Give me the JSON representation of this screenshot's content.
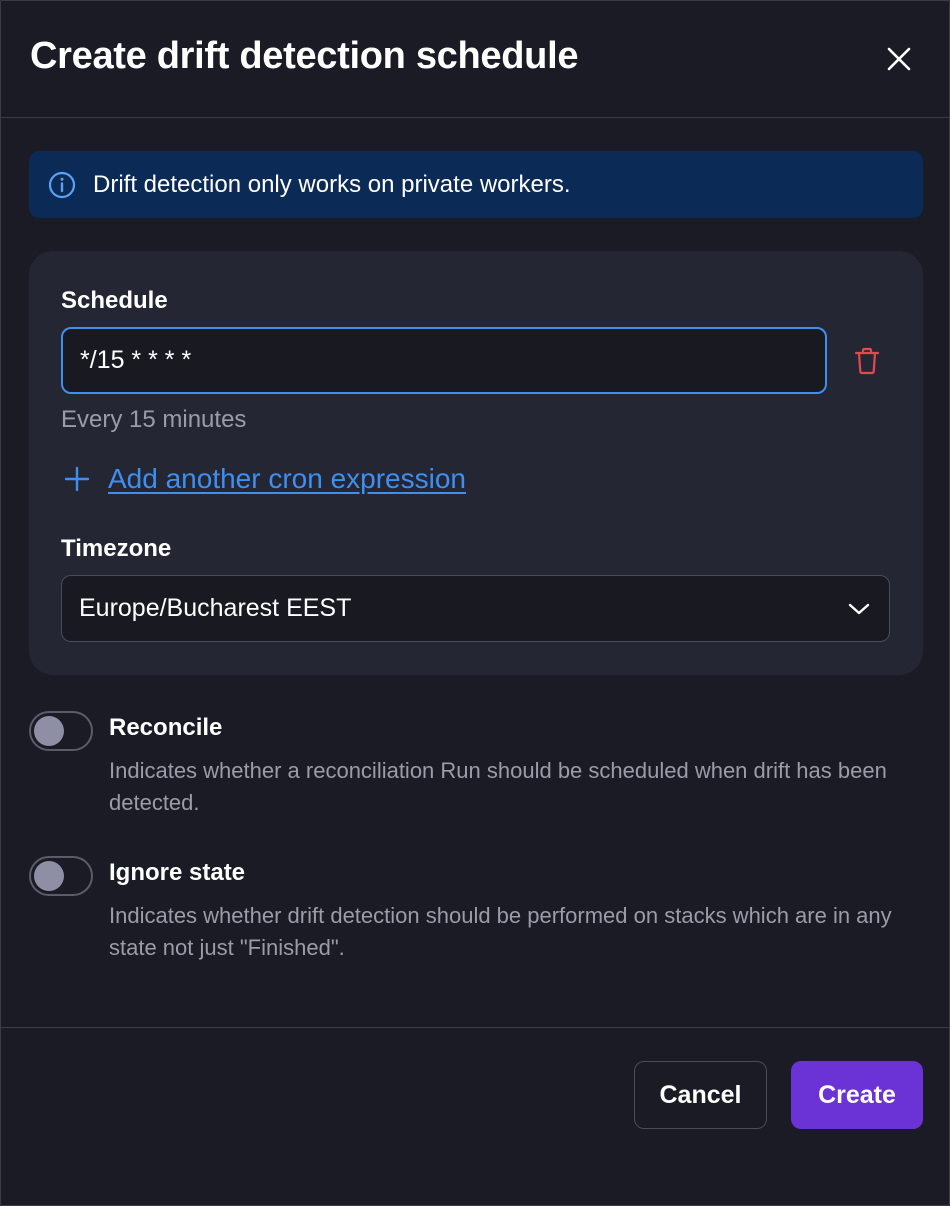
{
  "dialog": {
    "title": "Create drift detection schedule",
    "close_icon": "close-icon"
  },
  "info_banner": {
    "icon": "info-icon",
    "text": "Drift detection only works on private workers."
  },
  "schedule": {
    "label": "Schedule",
    "cron_value": "*/15 * * * *",
    "cron_description": "Every 15 minutes",
    "delete_icon": "trash-icon",
    "add_label": "Add another cron expression"
  },
  "timezone": {
    "label": "Timezone",
    "selected": "Europe/Bucharest EEST"
  },
  "options": [
    {
      "title": "Reconcile",
      "description": "Indicates whether a reconciliation Run should be scheduled when drift has been detected.",
      "enabled": false
    },
    {
      "title": "Ignore state",
      "description": "Indicates whether drift detection should be performed on stacks which are in any state not just \"Finished\".",
      "enabled": false
    }
  ],
  "footer": {
    "cancel_label": "Cancel",
    "create_label": "Create"
  },
  "colors": {
    "background": "#1a1b24",
    "card": "#252634",
    "info_banner": "#0b2a55",
    "accent_blue": "#3d8ff0",
    "primary_purple": "#6b33d6",
    "danger_red": "#e5484d"
  }
}
